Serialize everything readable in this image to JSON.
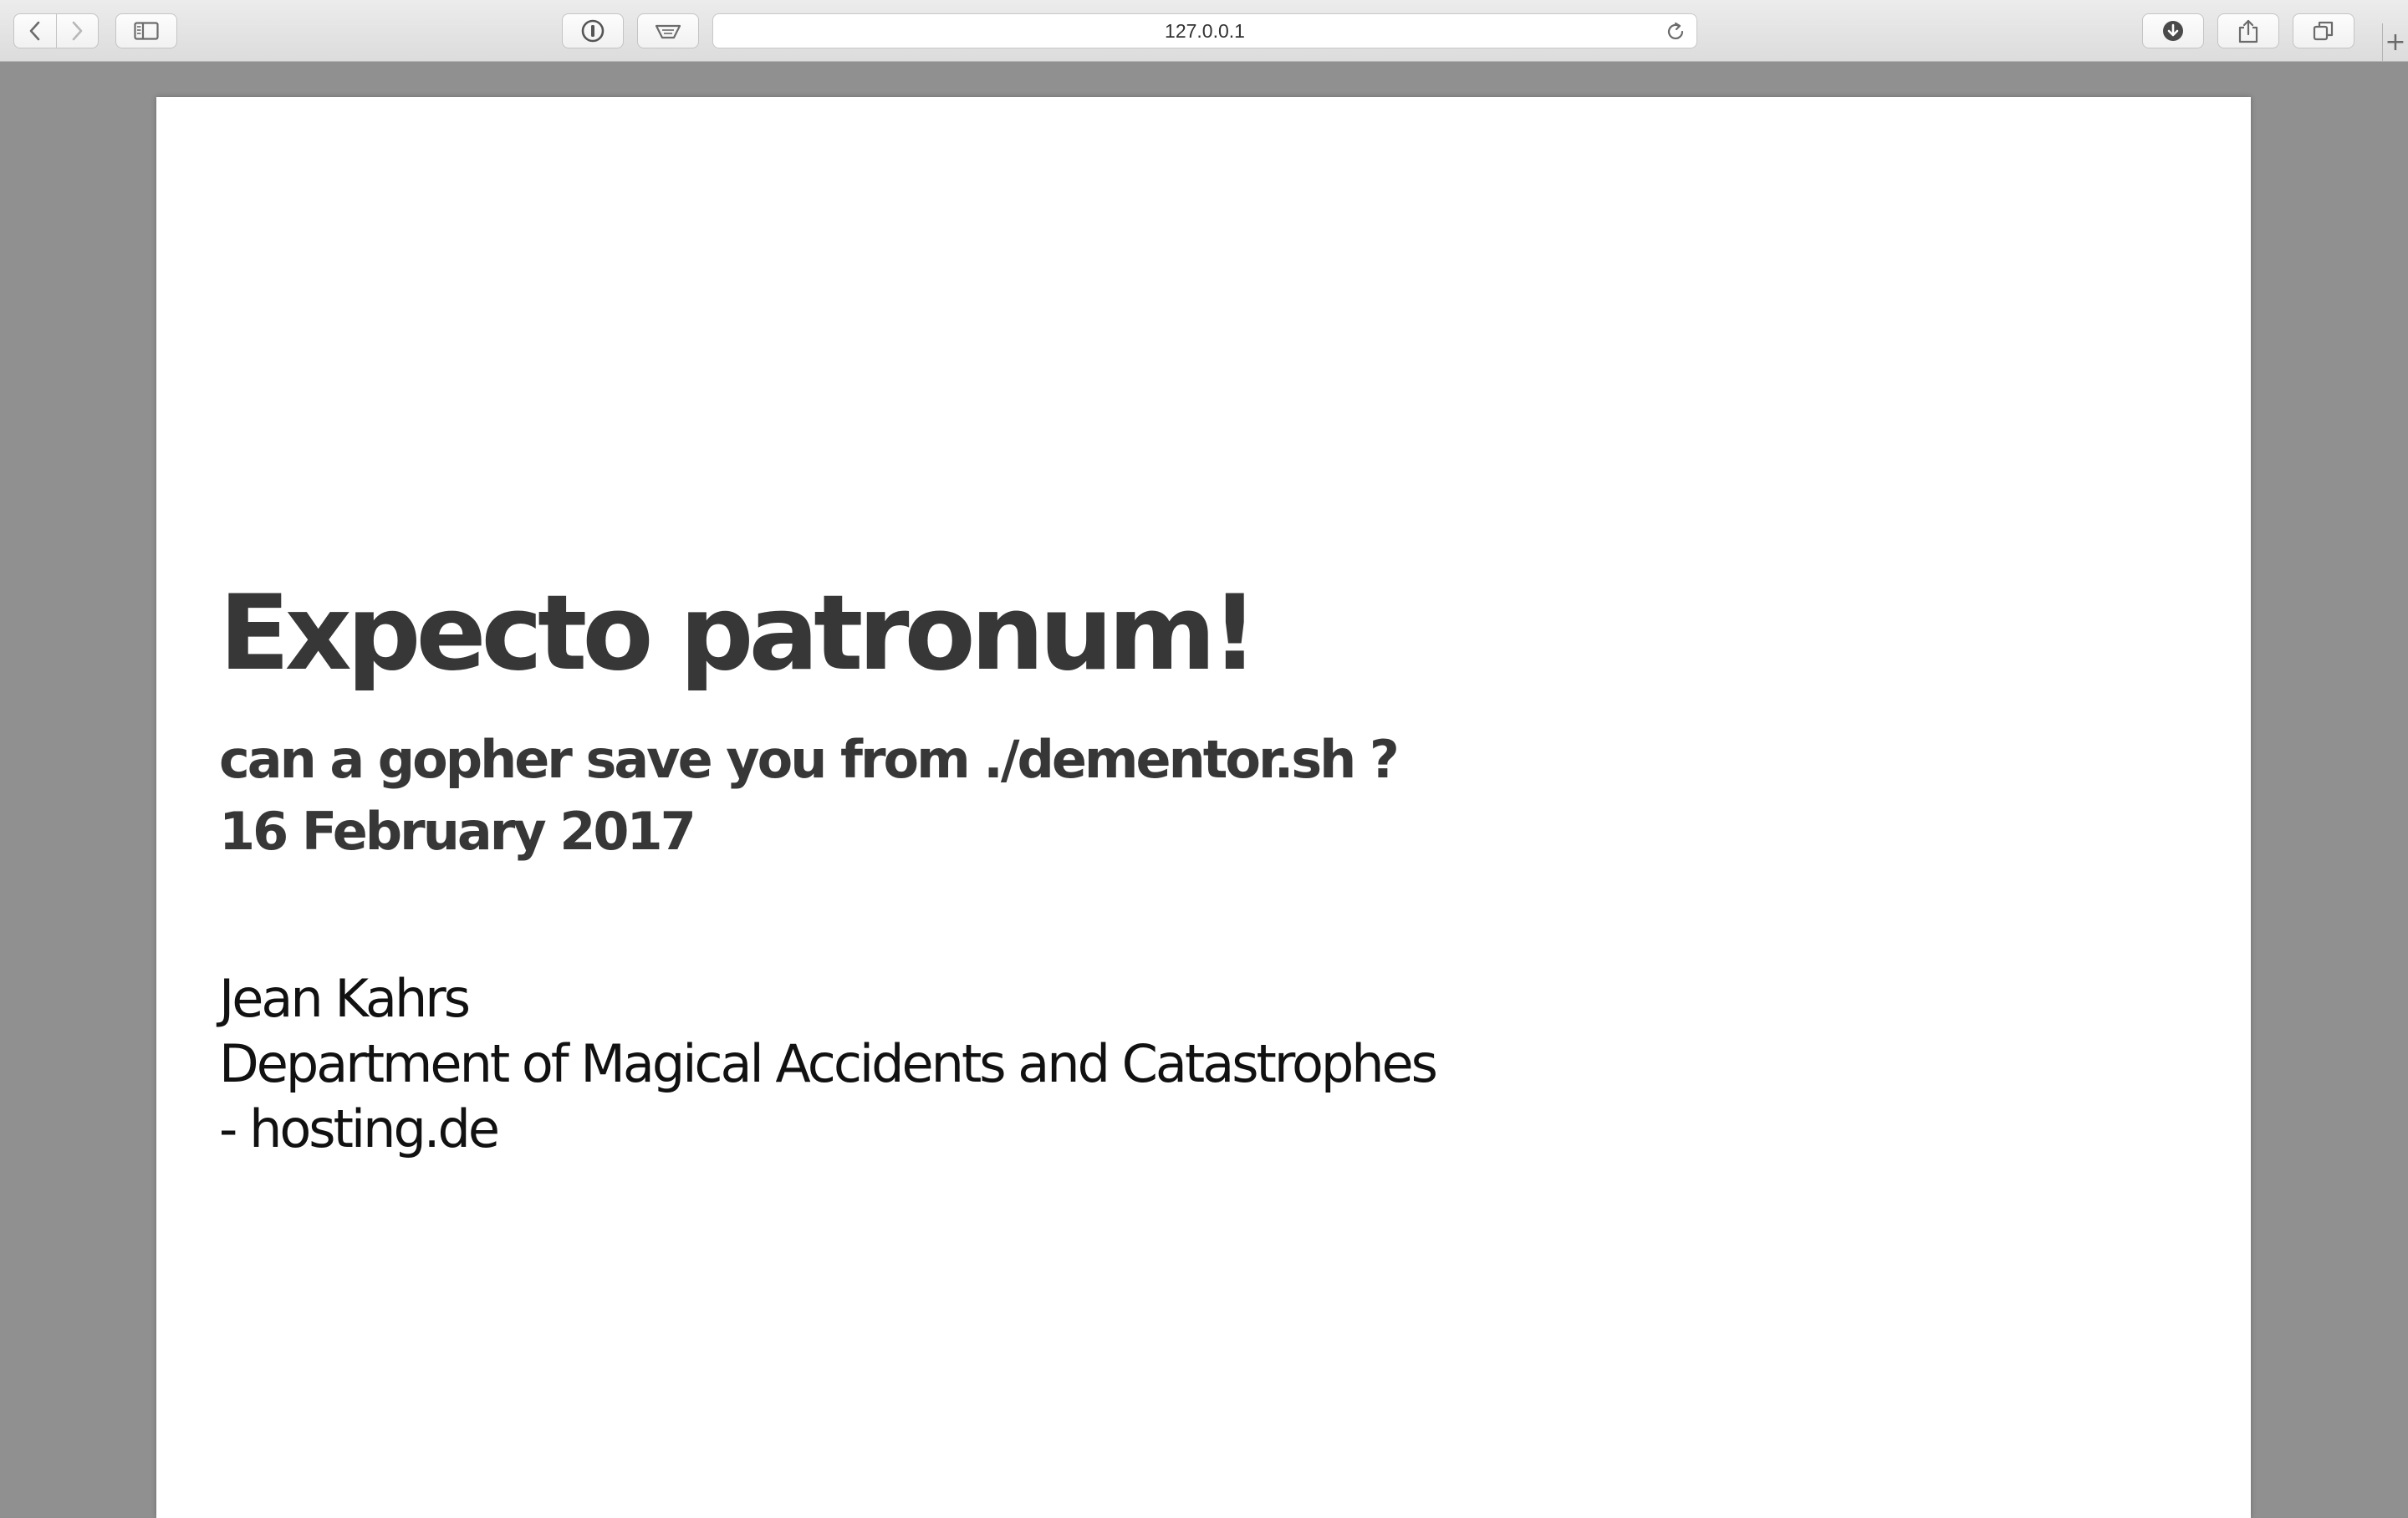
{
  "browser": {
    "address": "127.0.0.1",
    "icons": {
      "back": "chevron-left-icon",
      "forward": "chevron-right-icon",
      "sidebar": "sidebar-icon",
      "password": "password-manager-icon",
      "reader": "reader-icon",
      "reload": "reload-icon",
      "downloads": "download-icon",
      "share": "share-icon",
      "tabs": "tabs-overview-icon",
      "new_tab": "plus-icon"
    },
    "new_tab_glyph": "+"
  },
  "slide": {
    "title": "Expecto patronum!",
    "subtitle_lines": [
      "can a gopher save you from ./dementor.sh ?",
      "16 February 2017"
    ],
    "author_lines": [
      "Jean Kahrs",
      "Department of Magical Accidents and Catastrophes",
      "- hosting.de"
    ]
  }
}
